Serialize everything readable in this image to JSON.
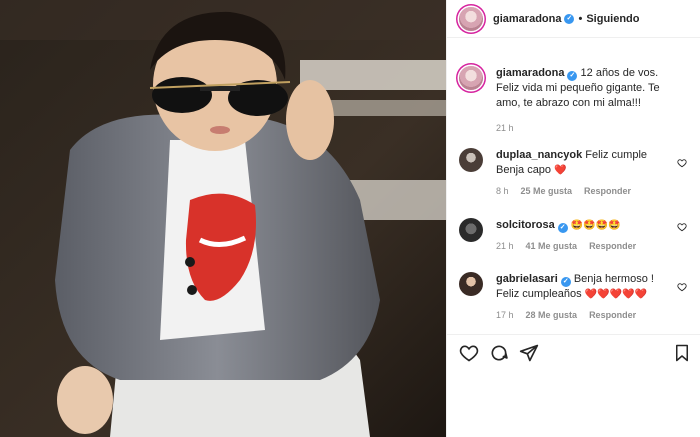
{
  "post": {
    "author": "giamaradona",
    "follow_status": "Siguiendo",
    "caption": "12 años de vos. Feliz vida mi pequeño gigante. Te amo, te abrazo con mi alma!!!",
    "time": "21 h"
  },
  "comments": [
    {
      "user": "duplaa_nancyok",
      "verified": false,
      "text": "Feliz cumple Benja capo",
      "emoji": "❤️",
      "time": "8 h",
      "likes": "25 Me gusta",
      "reply": "Responder"
    },
    {
      "user": "solcitorosa",
      "verified": true,
      "text": "",
      "emoji": "🤩🤩🤩🤩",
      "time": "21 h",
      "likes": "41 Me gusta",
      "reply": "Responder"
    },
    {
      "user": "gabrielasari",
      "verified": true,
      "text": "Benja hermoso ! Feliz cumpleaños",
      "emoji": "❤️❤️❤️❤️❤️",
      "time": "17 h",
      "likes": "28 Me gusta",
      "reply": "Responder"
    }
  ],
  "icons": {
    "like": "heart-icon",
    "comment": "comment-icon",
    "share": "share-icon",
    "save": "bookmark-icon",
    "verified": "verified-badge-icon"
  },
  "colors": {
    "verified": "#3897f0",
    "heart_emoji": "#ed1c24",
    "meta_text": "#8e8e8e"
  }
}
